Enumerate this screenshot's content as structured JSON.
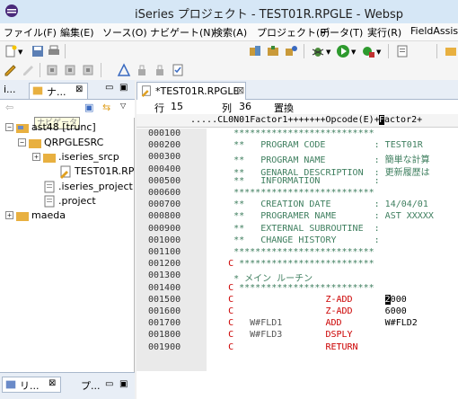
{
  "title": "iSeries プロジェクト - TEST01R.RPGLE - Websp",
  "menu": [
    "ファイル(F)",
    "編集(E)",
    "ソース(O)",
    "ナビゲート(N)",
    "検索(A)",
    "プロジェクト(P)",
    "データ(T)",
    "実行(R)",
    "FieldAssis"
  ],
  "left_pane": {
    "tab1": "i...",
    "tab2": "ナ...",
    "tab2_close": "⊠",
    "tooltip": "ナビゲータ",
    "tree": [
      {
        "label": "ast48 [trunc]",
        "icon": "project-icon",
        "expander": "−"
      },
      {
        "label": "QRPGLESRC",
        "icon": "folder-icon",
        "expander": "−"
      },
      {
        "label": ".iseries_srcp",
        "icon": "folder-icon",
        "expander": "+"
      },
      {
        "label": "TEST01R.RP",
        "icon": "rpg-file-icon",
        "expander": ""
      },
      {
        "label": ".iseries_project",
        "icon": "file-icon",
        "expander": ""
      },
      {
        "label": ".project",
        "icon": "file-icon",
        "expander": ""
      },
      {
        "label": "maeda",
        "icon": "folder-icon",
        "expander": "+"
      }
    ],
    "bottom_tab1": "リ...",
    "bottom_tab2": "プ..."
  },
  "editor": {
    "tab_label": "*TEST01R.RPGLE",
    "row_label": "行",
    "row_value": "15",
    "col_label": "列",
    "col_value": "36",
    "mode": "置換",
    "ruler_before": ".....CL0N01Factor1+++++++Opcode(E)+",
    "ruler_cursor": "F",
    "ruler_after": "actor2+",
    "lines": [
      {
        "seq": "000100",
        "kind": "cmt",
        "text": "     **************************"
      },
      {
        "seq": "000200",
        "kind": "cmt",
        "text": "     **   PROGRAM CODE         : TEST01R"
      },
      {
        "seq": "000300",
        "kind": "cmt",
        "text": "     **   PROGRAM NAME         : 簡単な計算"
      },
      {
        "seq": "000400",
        "kind": "cmt",
        "text": "     **   GENARAL DESCRIPTION  : 更新履歴は"
      },
      {
        "seq": "000500",
        "kind": "cmt",
        "text": "     **   INFORMATION          :"
      },
      {
        "seq": "000600",
        "kind": "cmt",
        "text": "     **************************"
      },
      {
        "seq": "000700",
        "kind": "cmt",
        "text": "     **   CREATION DATE        : 14/04/01"
      },
      {
        "seq": "000800",
        "kind": "cmt",
        "text": "     **   PROGRAMER NAME       : AST XXXXX"
      },
      {
        "seq": "000900",
        "kind": "cmt",
        "text": "     **   EXTERNAL SUBROUTINE  :"
      },
      {
        "seq": "001000",
        "kind": "cmt",
        "text": "     **   CHANGE HISTORY       :"
      },
      {
        "seq": "001100",
        "kind": "cmt",
        "text": "     **************************"
      },
      {
        "seq": "001200",
        "kind": "ccmt",
        "spec": "    C",
        "text": "*************************"
      },
      {
        "seq": "001300",
        "kind": "cmt",
        "text": "     * メイン ルーチン"
      },
      {
        "seq": "001400",
        "kind": "ccmt",
        "spec": "    C",
        "text": "*************************"
      },
      {
        "seq": "001500",
        "kind": "calc",
        "spec": "    C",
        "factor1": "",
        "opcode": "Z-ADD",
        "factor2": "2000",
        "cursor": true
      },
      {
        "seq": "001600",
        "kind": "calc",
        "spec": "    C",
        "factor1": "",
        "opcode": "Z-ADD",
        "factor2": "6000"
      },
      {
        "seq": "001700",
        "kind": "calc",
        "spec": "    C",
        "factor1": "W#FLD1",
        "opcode": "ADD",
        "factor2": "W#FLD2"
      },
      {
        "seq": "001800",
        "kind": "calc",
        "spec": "    C",
        "factor1": "W#FLD3",
        "opcode": "DSPLY",
        "factor2": ""
      },
      {
        "seq": "001900",
        "kind": "calc",
        "spec": "    C",
        "factor1": "",
        "opcode": "RETURN",
        "factor2": ""
      }
    ]
  },
  "colors": {
    "comment": "#3f7f5f",
    "spec": "#cc0000",
    "titlebar": "#d6e7f6"
  }
}
